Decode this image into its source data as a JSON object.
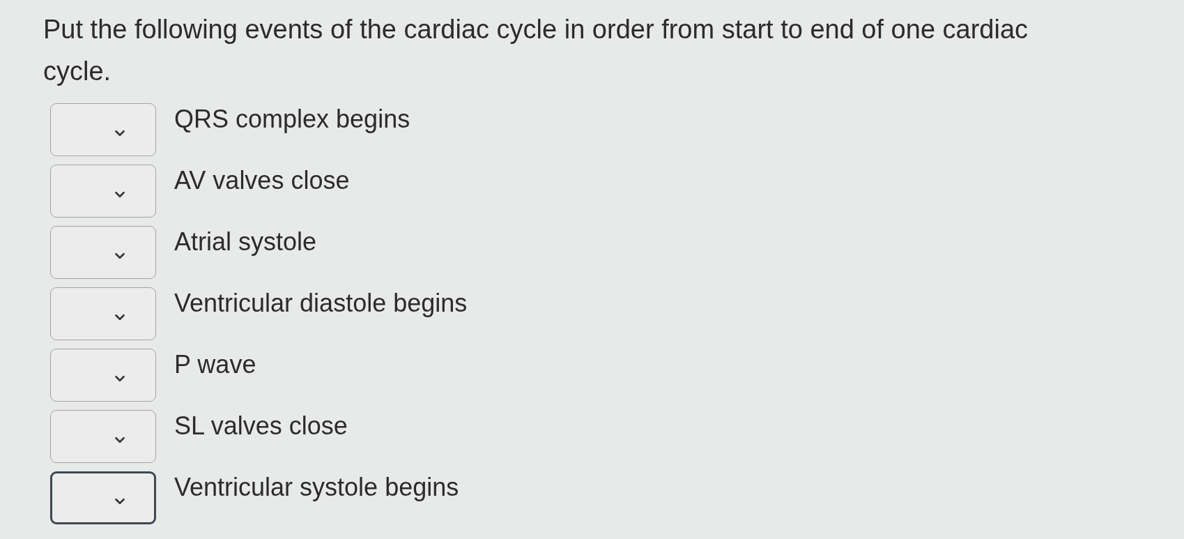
{
  "question": {
    "text": "Put the following events of the cardiac cycle in order from start to end of one cardiac cycle."
  },
  "items": [
    {
      "label": "QRS complex begins",
      "dropdown": {
        "focused": false
      }
    },
    {
      "label": "AV valves close",
      "dropdown": {
        "focused": false
      }
    },
    {
      "label": "Atrial systole",
      "dropdown": {
        "focused": false
      }
    },
    {
      "label": "Ventricular diastole begins",
      "dropdown": {
        "focused": false
      }
    },
    {
      "label": "P wave",
      "dropdown": {
        "focused": false
      }
    },
    {
      "label": "SL valves close",
      "dropdown": {
        "focused": false
      }
    },
    {
      "label": "Ventricular systole begins",
      "dropdown": {
        "focused": true
      }
    }
  ]
}
